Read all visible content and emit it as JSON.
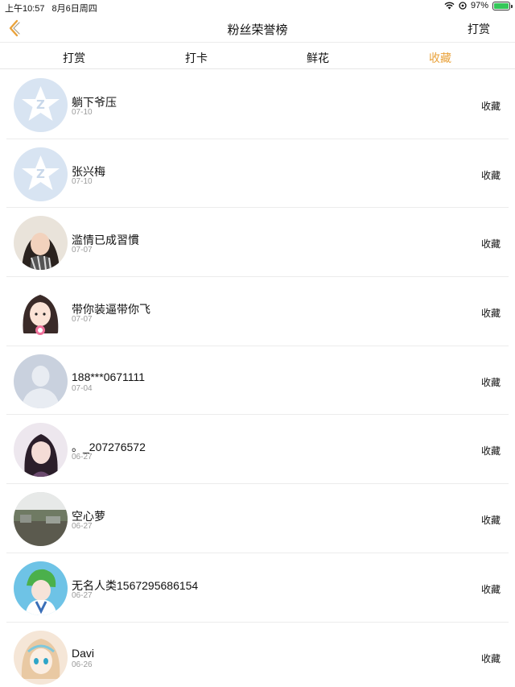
{
  "status_bar": {
    "time": "上午10:57",
    "date": "8月6日周四",
    "battery": "97%"
  },
  "nav": {
    "title": "粉丝荣誉榜",
    "right_label": "打赏"
  },
  "tabs": [
    {
      "label": "打赏"
    },
    {
      "label": "打卡"
    },
    {
      "label": "鲜花"
    },
    {
      "label": "收藏"
    }
  ],
  "active_tab": 3,
  "colors": {
    "accent": "#e9a23b",
    "battery": "#34c759"
  },
  "fans": [
    {
      "name": "躺下爷压",
      "date": "07-10",
      "action": "收藏",
      "avatar": "default-star-avatar"
    },
    {
      "name": "张兴梅",
      "date": "07-10",
      "action": "收藏",
      "avatar": "default-star-avatar"
    },
    {
      "name": "滥情已成習慣",
      "date": "07-07",
      "action": "收藏",
      "avatar": "photo-avatar"
    },
    {
      "name": "带你装逼带你飞",
      "date": "07-07",
      "action": "收藏",
      "avatar": "cartoon-girl-avatar"
    },
    {
      "name": "188***0671111",
      "date": "07-04",
      "action": "收藏",
      "avatar": "default-person-avatar"
    },
    {
      "name": "。_207276572",
      "date": "06-27",
      "action": "收藏",
      "avatar": "photo-avatar"
    },
    {
      "name": "空心萝",
      "date": "06-27",
      "action": "收藏",
      "avatar": "landscape-avatar"
    },
    {
      "name": "无名人类1567295686154",
      "date": "06-27",
      "action": "收藏",
      "avatar": "anime-avatar"
    },
    {
      "name": "Davi",
      "date": "06-26",
      "action": "收藏",
      "avatar": "anime-avatar"
    }
  ]
}
